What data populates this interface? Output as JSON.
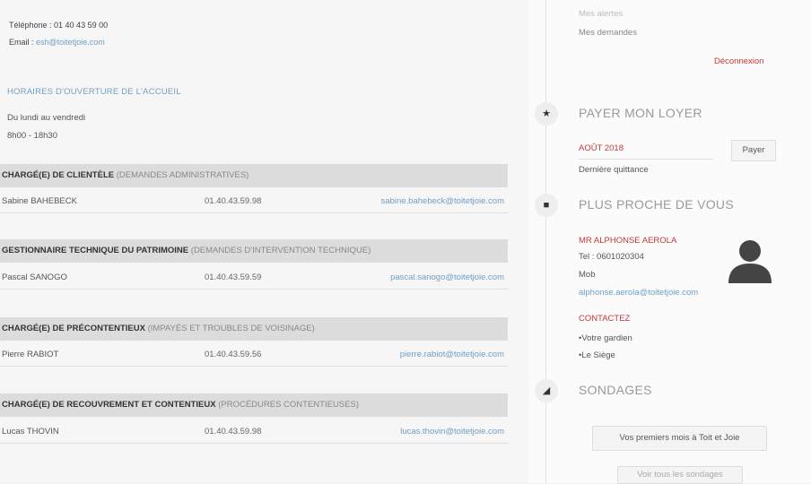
{
  "contact": {
    "phone_label": "Téléphone : 01 40 43 59 00",
    "email_label": "Email :",
    "email_value": "esh@toitetjoie.com"
  },
  "hours": {
    "title": "HORAIRES D'OUVERTURE DE L'ACCUEIL",
    "days": "Du lundi au vendredi",
    "time": "8h00 - 18h30"
  },
  "sections": [
    {
      "title": "CHARGÉ(E) DE CLIENTÈLE",
      "subtitle": "(DEMANDES ADMINISTRATIVES)",
      "name": "Sabine BAHEBECK",
      "phone": "01.40.43.59.98",
      "email": "sabine.bahebeck@toitetjoie.com"
    },
    {
      "title": "GESTIONNAIRE TECHNIQUE DU PATRIMOINE",
      "subtitle": "(DEMANDES D'INTERVENTION TECHNIQUE)",
      "name": "Pascal SANOGO",
      "phone": "01.40.43.59.59",
      "email": "pascal.sanogo@toitetjoie.com"
    },
    {
      "title": "CHARGÉ(E) DE PRÉCONTENTIEUX",
      "subtitle": "(IMPAYÉS ET TROUBLES DE VOISINAGE)",
      "name": "Pierre RABIOT",
      "phone": "01.40.43.59.56",
      "email": "pierre.rabiot@toitetjoie.com"
    },
    {
      "title": "CHARGÉ(E) DE RECOUVREMENT ET CONTENTIEUX",
      "subtitle": "(PROCÉDURES CONTENTIEUSES)",
      "name": "Lucas THOVIN",
      "phone": "01.40.43.59.98",
      "email": "lucas.thovin@toitetjoie.com"
    }
  ],
  "menu": {
    "item1": "Mes alertes",
    "item2": "Mes demandes",
    "logout": "Déconnexion"
  },
  "pay": {
    "icon": "star-icon",
    "title": "PAYER MON LOYER",
    "month": "AOÛT 2018",
    "button": "Payer",
    "receipt": "Dernière quittance"
  },
  "nearby": {
    "icon": "chat-icon",
    "title": "PLUS PROCHE DE VOUS",
    "person": "MR ALPHONSE AEROLA",
    "tel": "Tel : 0601020304",
    "mobile": "Mob",
    "email": "alphonse.aerola@toitetjoie.com",
    "contact_title": "CONTACTEZ",
    "contact1": "•Votre gardien",
    "contact2": "•Le Siège"
  },
  "surveys": {
    "icon": "megaphone-icon",
    "title": "SONDAGES",
    "button": "Vos premiers mois à Toit et Joie",
    "more": "Voir tous les sondages"
  }
}
